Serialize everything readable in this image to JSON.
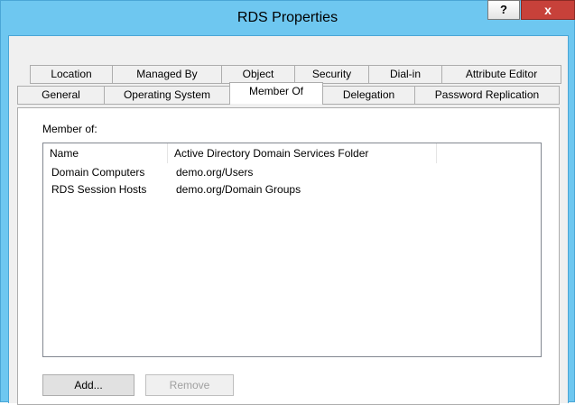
{
  "window": {
    "title": "RDS Properties",
    "help_label": "?",
    "close_label": "x"
  },
  "tabs_row1": [
    {
      "label": "Location"
    },
    {
      "label": "Managed By"
    },
    {
      "label": "Object"
    },
    {
      "label": "Security"
    },
    {
      "label": "Dial-in"
    },
    {
      "label": "Attribute Editor"
    }
  ],
  "tabs_row2": [
    {
      "label": "General"
    },
    {
      "label": "Operating System"
    },
    {
      "label": "Member Of",
      "selected": true
    },
    {
      "label": "Delegation"
    },
    {
      "label": "Password Replication"
    }
  ],
  "member_of": {
    "label": "Member of:",
    "columns": [
      "Name",
      "Active Directory Domain Services Folder"
    ],
    "rows": [
      {
        "name": "Domain Computers",
        "folder": "demo.org/Users"
      },
      {
        "name": "RDS Session Hosts",
        "folder": "demo.org/Domain Groups"
      }
    ]
  },
  "buttons": {
    "add": "Add...",
    "remove": "Remove"
  }
}
